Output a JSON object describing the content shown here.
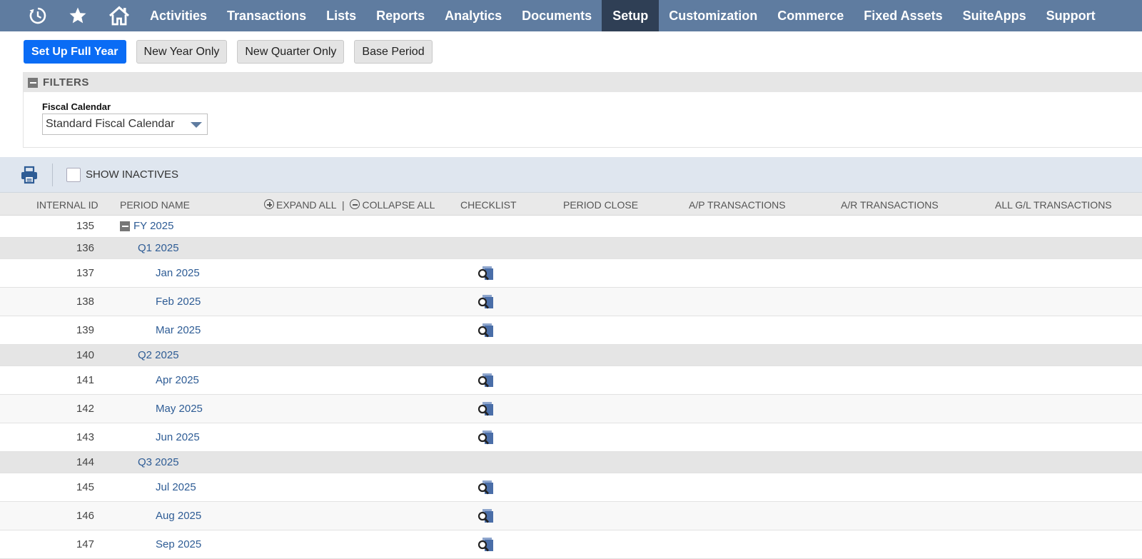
{
  "nav": {
    "icons": [
      "recent-history-icon",
      "favorites-star-icon",
      "home-icon"
    ],
    "items": [
      {
        "label": "Activities",
        "active": false
      },
      {
        "label": "Transactions",
        "active": false
      },
      {
        "label": "Lists",
        "active": false
      },
      {
        "label": "Reports",
        "active": false
      },
      {
        "label": "Analytics",
        "active": false
      },
      {
        "label": "Documents",
        "active": false
      },
      {
        "label": "Setup",
        "active": true
      },
      {
        "label": "Customization",
        "active": false
      },
      {
        "label": "Commerce",
        "active": false
      },
      {
        "label": "Fixed Assets",
        "active": false
      },
      {
        "label": "SuiteApps",
        "active": false
      },
      {
        "label": "Support",
        "active": false
      }
    ]
  },
  "buttons": {
    "setup_full_year": "Set Up Full Year",
    "new_year_only": "New Year Only",
    "new_quarter_only": "New Quarter Only",
    "base_period": "Base Period"
  },
  "filters": {
    "title": "FILTERS",
    "fiscal_calendar_label": "Fiscal Calendar",
    "fiscal_calendar_value": "Standard Fiscal Calendar"
  },
  "toolbar": {
    "show_inactives_label": "SHOW INACTIVES",
    "show_inactives_checked": false
  },
  "columns": {
    "internal_id": "INTERNAL ID",
    "period_name": "PERIOD NAME",
    "expand_all": "EXPAND ALL",
    "separator": "|",
    "collapse_all": "COLLAPSE ALL",
    "checklist": "CHECKLIST",
    "period_close": "PERIOD CLOSE",
    "ap_transactions": "A/P TRANSACTIONS",
    "ar_transactions": "A/R TRANSACTIONS",
    "all_gl_transactions": "ALL G/L TRANSACTIONS"
  },
  "rows": [
    {
      "id": "135",
      "name": "FY 2025",
      "level": "fy"
    },
    {
      "id": "136",
      "name": "Q1 2025",
      "level": "quarter"
    },
    {
      "id": "137",
      "name": "Jan 2025",
      "level": "month"
    },
    {
      "id": "138",
      "name": "Feb 2025",
      "level": "month"
    },
    {
      "id": "139",
      "name": "Mar 2025",
      "level": "month"
    },
    {
      "id": "140",
      "name": "Q2 2025",
      "level": "quarter"
    },
    {
      "id": "141",
      "name": "Apr 2025",
      "level": "month"
    },
    {
      "id": "142",
      "name": "May 2025",
      "level": "month"
    },
    {
      "id": "143",
      "name": "Jun 2025",
      "level": "month"
    },
    {
      "id": "144",
      "name": "Q3 2025",
      "level": "quarter"
    },
    {
      "id": "145",
      "name": "Jul 2025",
      "level": "month"
    },
    {
      "id": "146",
      "name": "Aug 2025",
      "level": "month"
    },
    {
      "id": "147",
      "name": "Sep 2025",
      "level": "month"
    }
  ],
  "colors": {
    "nav_bg": "#5f7ca0",
    "nav_active_bg": "#2f3f55",
    "primary_button": "#0a6cf5",
    "link": "#2e5c95"
  }
}
